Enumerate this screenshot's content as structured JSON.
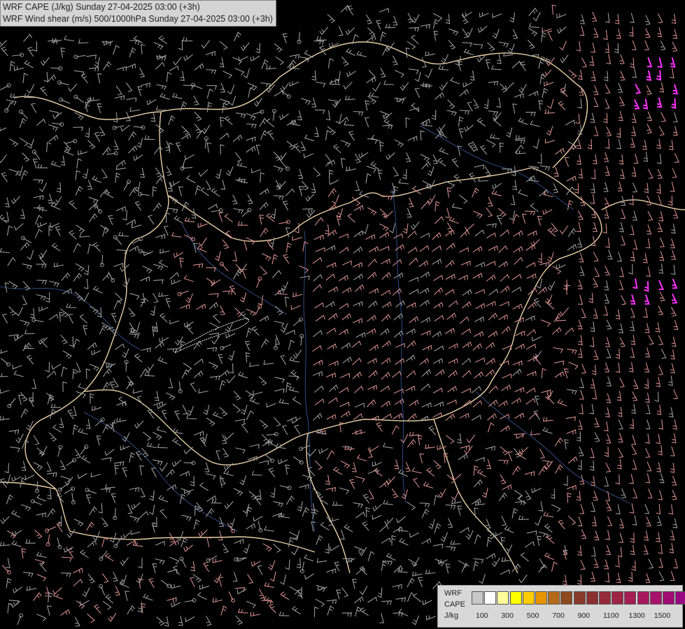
{
  "header": {
    "line1": "WRF CAPE (J/kg) Sunday 27-04-2025 03:00 (+3h)",
    "line2": "WRF Wind shear (m/s) 500/1000hPa Sunday 27-04-2025 03:00 (+3h)"
  },
  "legend": {
    "label_line1": "WRF",
    "label_line2": "CAPE",
    "label_line3": "J/kg",
    "swatches": [
      "#c8c8c8",
      "#ffffff",
      "#ffff99",
      "#ffff00",
      "#ffcc00",
      "#e69500",
      "#b56a1a",
      "#8c4a1e",
      "#8a3a2a",
      "#8a3030",
      "#952a3a",
      "#9e2446",
      "#a51e52",
      "#a8185e",
      "#a8126a",
      "#a00c74",
      "#990880"
    ],
    "tick_labels": [
      "100",
      "300",
      "500",
      "700",
      "900",
      "1100",
      "1300",
      "1500"
    ]
  },
  "colors": {
    "background": "#000000",
    "barb_gray": "#9a9a9a",
    "barb_pink": "#d08a8a",
    "barb_magenta": "#ff33ff",
    "border": "#e8cfa6",
    "river": "#3b5a9c"
  }
}
